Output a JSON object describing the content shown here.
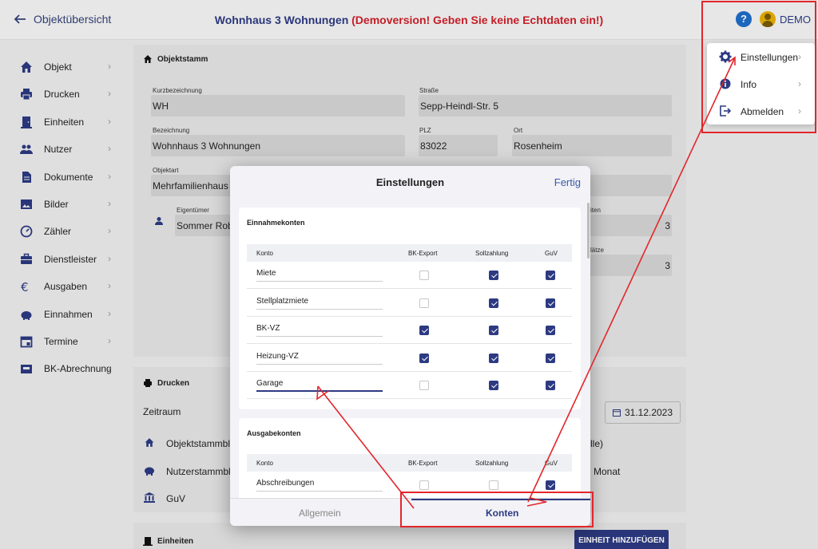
{
  "header": {
    "back_label": "Objektübersicht",
    "title_name": "Wohnhaus 3 Wohnungen",
    "title_warning": "(Demoversion! Geben Sie keine Echtdaten ein!)",
    "help_label": "?",
    "user_label": "DEMO"
  },
  "sidebar": {
    "items": [
      {
        "label": "Objekt",
        "icon": "home-icon"
      },
      {
        "label": "Drucken",
        "icon": "printer-icon"
      },
      {
        "label": "Einheiten",
        "icon": "door-icon"
      },
      {
        "label": "Nutzer",
        "icon": "users-icon"
      },
      {
        "label": "Dokumente",
        "icon": "document-icon"
      },
      {
        "label": "Bilder",
        "icon": "image-icon"
      },
      {
        "label": "Zähler",
        "icon": "gauge-icon"
      },
      {
        "label": "Dienstleister",
        "icon": "briefcase-icon"
      },
      {
        "label": "Ausgaben",
        "icon": "euro-icon"
      },
      {
        "label": "Einnahmen",
        "icon": "piggy-bank-icon"
      },
      {
        "label": "Termine",
        "icon": "calendar-icon"
      },
      {
        "label": "BK-Abrechnung",
        "icon": "invoice-icon"
      }
    ]
  },
  "objektstamm": {
    "heading": "Objektstamm",
    "kurz_label": "Kurzbezeichnung",
    "kurz_value": "WH",
    "strasse_label": "Straße",
    "strasse_value": "Sepp-Heindl-Str. 5",
    "bez_label": "Bezeichnung",
    "bez_value": "Wohnhaus 3 Wohnungen",
    "plz_label": "PLZ",
    "plz_value": "83022",
    "ort_label": "Ort",
    "ort_value": "Rosenheim",
    "art_label": "Objektart",
    "art_value": "Mehrfamilienhaus",
    "eig_label": "Eigentümer",
    "eig_value": "Sommer Rob",
    "einheiten_label": "iten",
    "einheiten_value": "3",
    "plaetze_label": "lätze",
    "plaetze_value": "3"
  },
  "drucken": {
    "heading": "Drucken",
    "zeitraum_label": "Zeitraum",
    "date_value": "31.12.2023",
    "row1": "Objektstammbla",
    "row1_right": "lle)",
    "row2": "Nutzerstammbla",
    "row2_right": "h Monat",
    "row3": "GuV"
  },
  "einheiten": {
    "heading": "Einheiten",
    "add_button": "EINHEIT HINZUFÜGEN"
  },
  "user_menu": {
    "items": [
      {
        "label": "Einstellungen",
        "icon": "gear-icon"
      },
      {
        "label": "Info",
        "icon": "info-icon"
      },
      {
        "label": "Abmelden",
        "icon": "logout-icon"
      }
    ]
  },
  "modal": {
    "title": "Einstellungen",
    "done": "Fertig",
    "einnahmen": {
      "title": "Einnahmekonten",
      "headers": {
        "konto": "Konto",
        "bk": "BK-Export",
        "soll": "Sollzahlung",
        "guv": "GuV"
      },
      "rows": [
        {
          "konto": "Miete",
          "bk": false,
          "soll": true,
          "guv": true
        },
        {
          "konto": "Stellplatzmiete",
          "bk": false,
          "soll": true,
          "guv": true
        },
        {
          "konto": "BK-VZ",
          "bk": true,
          "soll": true,
          "guv": true
        },
        {
          "konto": "Heizung-VZ",
          "bk": true,
          "soll": true,
          "guv": true
        },
        {
          "konto": "Garage",
          "bk": false,
          "soll": true,
          "guv": true
        }
      ]
    },
    "ausgaben": {
      "title": "Ausgabekonten",
      "headers": {
        "konto": "Konto",
        "bk": "BK-Export",
        "soll": "Sollzahlung",
        "guv": "GuV"
      },
      "rows": [
        {
          "konto": "Abschreibungen",
          "bk": false,
          "soll": false,
          "guv": true
        }
      ]
    },
    "tabs": {
      "allgemein": "Allgemein",
      "konten": "Konten"
    }
  },
  "colors": {
    "accent": "#2d3a82",
    "warning": "#d0202a",
    "annotation": "#e3262b"
  }
}
